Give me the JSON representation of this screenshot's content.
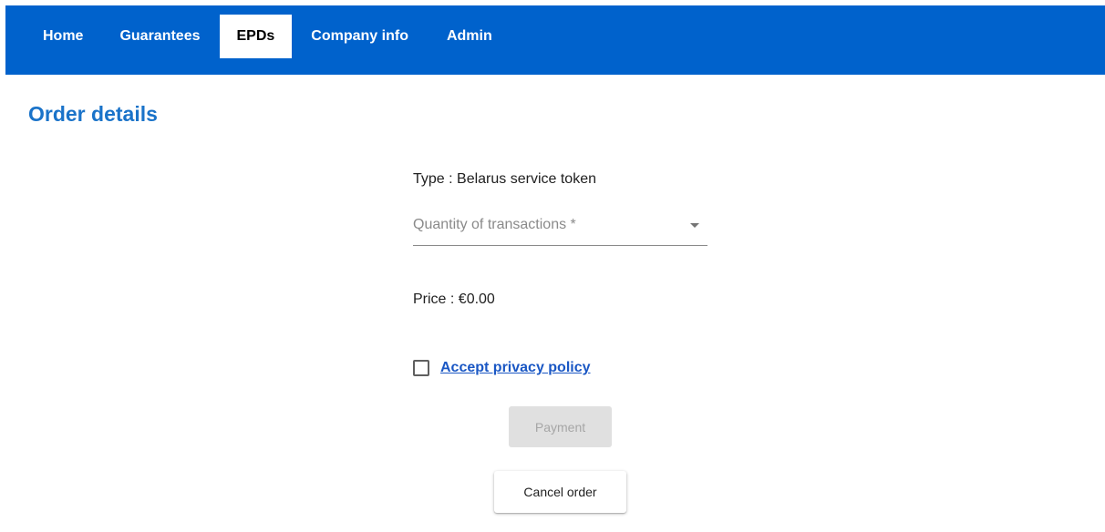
{
  "nav": {
    "items": [
      {
        "label": "Home"
      },
      {
        "label": "Guarantees"
      },
      {
        "label": "EPDs",
        "active": true
      },
      {
        "label": "Company info"
      },
      {
        "label": "Admin"
      }
    ]
  },
  "page": {
    "title": "Order details"
  },
  "order": {
    "type_text": "Type : Belarus service token",
    "quantity_placeholder": "Quantity of transactions *",
    "price_text": "Price : €0.00",
    "privacy_checked": false,
    "privacy_label": "Accept privacy policy",
    "payment_label": "Payment",
    "cancel_label": "Cancel order"
  },
  "colors": {
    "nav_background": "#0062cc",
    "title": "#1a73c9",
    "link": "#1a57c4",
    "disabled_button_bg": "#e0e0e0"
  }
}
